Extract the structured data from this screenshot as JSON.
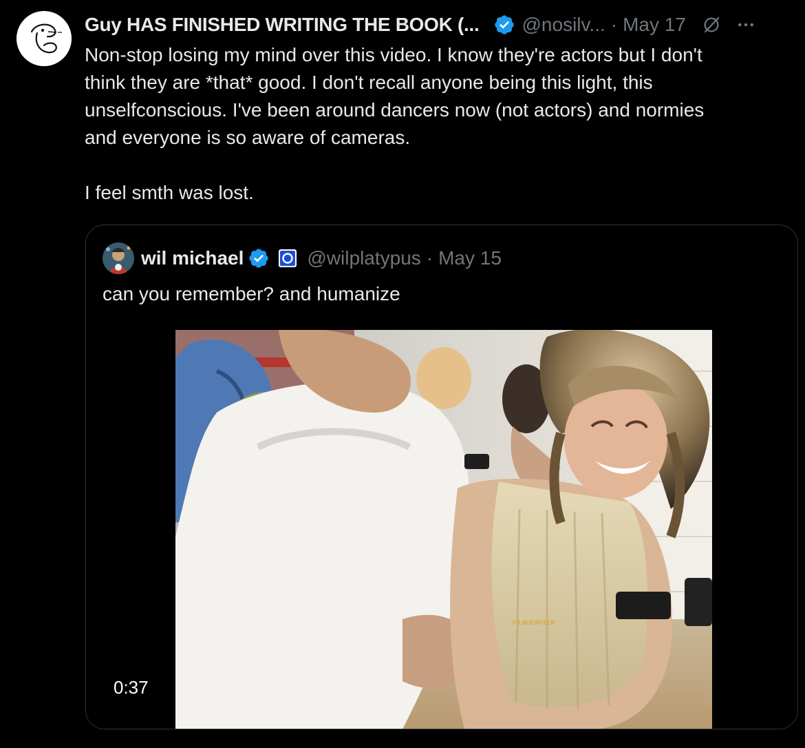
{
  "tweet": {
    "display_name": "Guy HAS FINISHED WRITING THE BOOK (...",
    "handle": "@nosilv...",
    "separator": "·",
    "date": "May 17",
    "verified_icon": "verified-badge-icon",
    "grok_icon": "grok-icon",
    "more_icon": "more-icon",
    "text_lines": [
      "Non-stop losing my mind over this video. I know they're actors but I don't",
      "think they are *that* good. I don't recall anyone being this light, this",
      "unselfconscious. I've been around dancers now (not actors) and normies",
      "and everyone is so aware of cameras."
    ],
    "text_last": "I feel smth was lost."
  },
  "quote": {
    "display_name": "wil michael",
    "handle": "@wilplatypus",
    "separator": "·",
    "date": "May 15",
    "text": "can you remember? and humanize",
    "video": {
      "duration": "0:37",
      "watermark": "FILMJUPITER"
    }
  },
  "colors": {
    "background": "#000000",
    "text": "#e7e9ea",
    "secondary": "#71767b",
    "verified": "#1d9bf0",
    "border": "#2f3336"
  }
}
